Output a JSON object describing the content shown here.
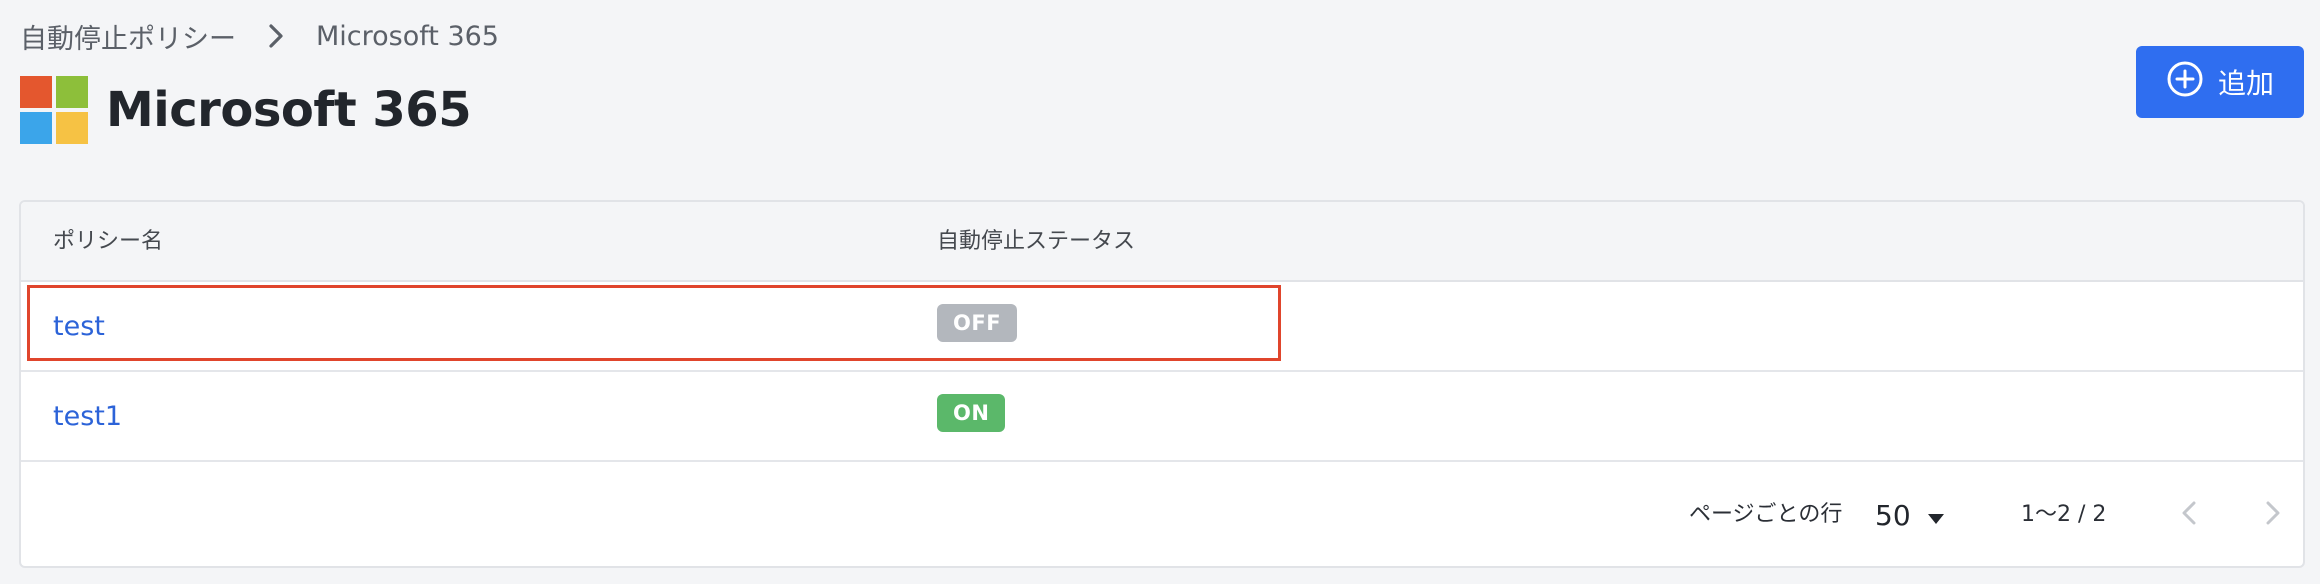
{
  "breadcrumb": {
    "parent": "自動停止ポリシー",
    "current": "Microsoft 365"
  },
  "header": {
    "title": "Microsoft 365",
    "logo_icon": "microsoft-logo-icon",
    "add_button_label": "追加",
    "add_button_icon": "plus-circle-icon",
    "accent_color": "#2f6ef0"
  },
  "table": {
    "columns": [
      "ポリシー名",
      "自動停止ステータス"
    ],
    "rows": [
      {
        "name": "test",
        "status": "OFF",
        "status_color": "#b3b7bd",
        "highlighted": true
      },
      {
        "name": "test1",
        "status": "ON",
        "status_color": "#5bb86a",
        "highlighted": false
      }
    ],
    "highlight_color": "#e0452c"
  },
  "pagination": {
    "rows_per_page_label": "ページごとの行",
    "rows_per_page": "50",
    "range": "1〜2 / 2",
    "prev_icon": "chevron-left-icon",
    "next_icon": "chevron-right-icon"
  }
}
